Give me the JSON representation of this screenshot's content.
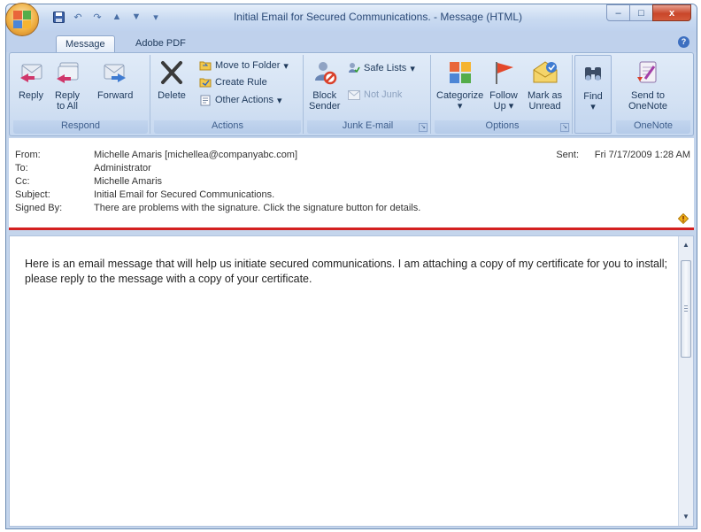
{
  "window": {
    "title": "Initial Email for Secured Communications. - Message (HTML)",
    "controls": {
      "minimize": "–",
      "maximize": "□",
      "close": "x"
    }
  },
  "tabs": [
    {
      "label": "Message",
      "active": true
    },
    {
      "label": "Adobe PDF",
      "active": false
    }
  ],
  "ribbon": {
    "respond": {
      "label": "Respond",
      "reply": "Reply",
      "reply_all_1": "Reply",
      "reply_all_2": "to All",
      "forward": "Forward"
    },
    "actions": {
      "label": "Actions",
      "delete": "Delete",
      "move_to_folder": "Move to Folder",
      "create_rule": "Create Rule",
      "other_actions": "Other Actions"
    },
    "junk": {
      "label": "Junk E-mail",
      "block_sender_1": "Block",
      "block_sender_2": "Sender",
      "safe_lists": "Safe Lists",
      "not_junk": "Not Junk"
    },
    "options": {
      "label": "Options",
      "categorize": "Categorize",
      "follow_up_1": "Follow",
      "follow_up_2": "Up",
      "mark_unread_1": "Mark as",
      "mark_unread_2": "Unread"
    },
    "find": {
      "label": "Find"
    },
    "onenote": {
      "label": "OneNote",
      "send_1": "Send to",
      "send_2": "OneNote"
    }
  },
  "header": {
    "from_label": "From:",
    "from": "Michelle Amaris [michellea@companyabc.com]",
    "to_label": "To:",
    "to": "Administrator",
    "cc_label": "Cc:",
    "cc": "Michelle Amaris",
    "subject_label": "Subject:",
    "subject": "Initial Email for Secured Communications.",
    "signed_label": "Signed By:",
    "signed": "There are problems with the signature. Click the signature button for details.",
    "sent_label": "Sent:",
    "sent": "Fri 7/17/2009 1:28 AM"
  },
  "body": {
    "text": "Here is an email message that will help us initiate secured communications. I am attaching a copy of my certificate for you to install; please reply to the message with a copy of your certificate."
  },
  "colors": {
    "accent_red": "#d42020",
    "ribbon_blue": "#d3e1f3"
  }
}
